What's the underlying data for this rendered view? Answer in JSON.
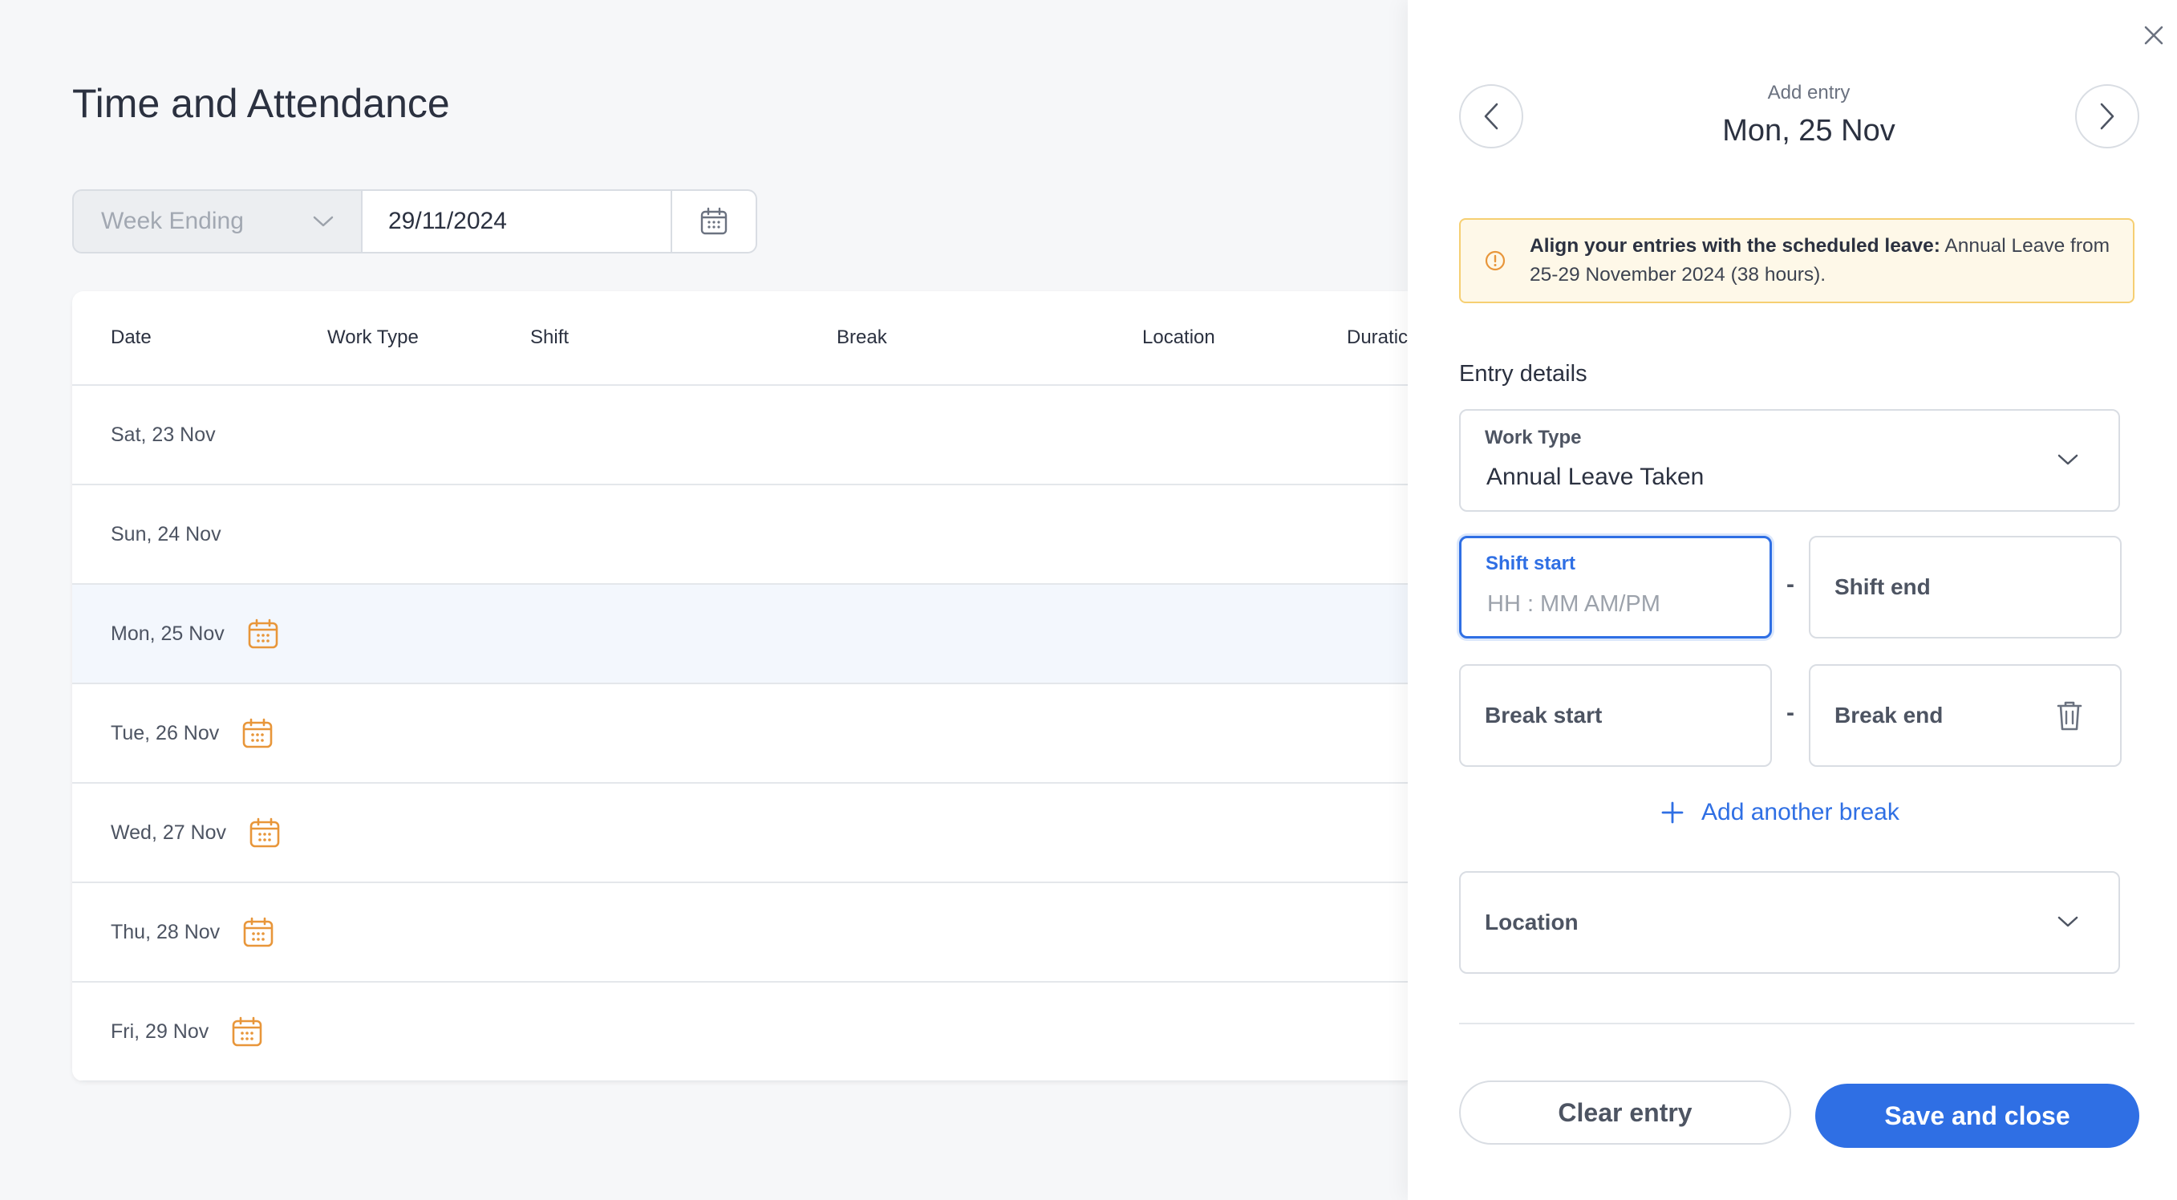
{
  "page": {
    "title": "Time and Attendance",
    "filter": {
      "period_label": "Week Ending",
      "date_value": "29/11/2024"
    },
    "table": {
      "columns": [
        "Date",
        "Work Type",
        "Shift",
        "Break",
        "Location",
        "Duratic"
      ],
      "rows": [
        {
          "date": "Sat, 23 Nov",
          "leave": false,
          "selected": false
        },
        {
          "date": "Sun, 24 Nov",
          "leave": false,
          "selected": false
        },
        {
          "date": "Mon, 25 Nov",
          "leave": true,
          "selected": true
        },
        {
          "date": "Tue, 26 Nov",
          "leave": true,
          "selected": false
        },
        {
          "date": "Wed, 27 Nov",
          "leave": true,
          "selected": false
        },
        {
          "date": "Thu, 28 Nov",
          "leave": true,
          "selected": false
        },
        {
          "date": "Fri, 29 Nov",
          "leave": true,
          "selected": false
        }
      ]
    }
  },
  "drawer": {
    "subtitle": "Add entry",
    "title": "Mon, 25 Nov",
    "alert": {
      "bold": "Align your entries with the scheduled leave:",
      "text": " Annual Leave from 25-29 November 2024 (38 hours)."
    },
    "section_label": "Entry details",
    "work_type": {
      "label": "Work Type",
      "value": "Annual Leave Taken"
    },
    "shift_start": {
      "label": "Shift start",
      "placeholder": "HH :  MM AM/PM"
    },
    "shift_end": {
      "label": "Shift end"
    },
    "separator": "-",
    "break_start": {
      "label": "Break start"
    },
    "break_end": {
      "label": "Break end"
    },
    "add_break": "Add another break",
    "location": {
      "label": "Location"
    },
    "clear_button": "Clear entry",
    "save_button": "Save and close"
  },
  "colors": {
    "accent": "#2f6fe4",
    "leave_icon": "#e8963a",
    "alert_bg": "#fef8e8",
    "alert_border": "#f6cf72"
  },
  "icons": [
    "chevron-down-icon",
    "calendar-icon",
    "leave-calendar-icon",
    "close-icon",
    "chevron-left-icon",
    "chevron-right-icon",
    "info-icon",
    "trash-icon",
    "plus-icon"
  ]
}
